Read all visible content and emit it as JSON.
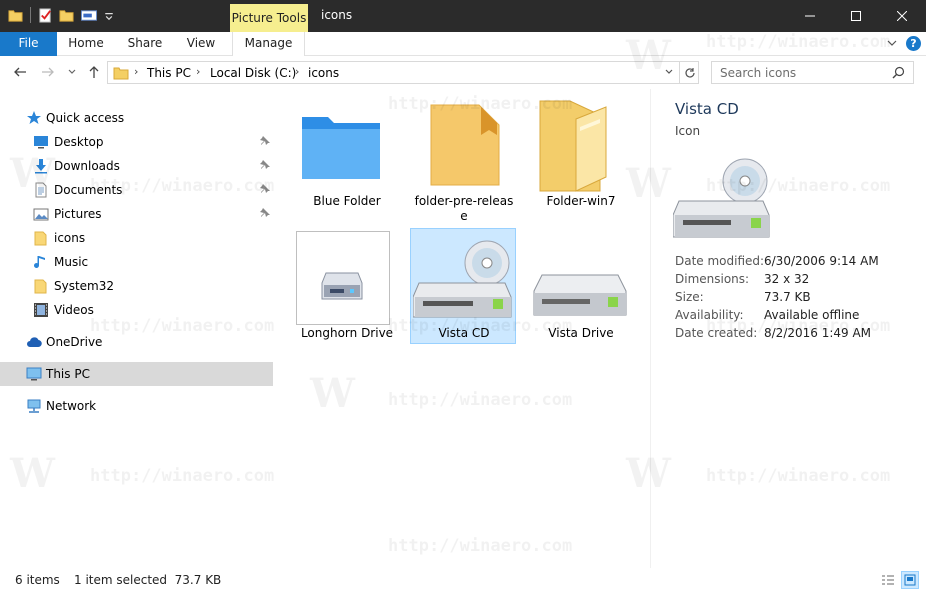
{
  "window": {
    "title": "icons",
    "contextual_tab": "Picture Tools",
    "accent_color": "#1979ca",
    "contextual_color": "#f6ee8f"
  },
  "ribbon": {
    "tabs": [
      {
        "label": "File"
      },
      {
        "label": "Home"
      },
      {
        "label": "Share"
      },
      {
        "label": "View"
      },
      {
        "label": "Manage"
      }
    ],
    "help": "?"
  },
  "address": {
    "crumbs": [
      "This PC",
      "Local Disk (C:)",
      "icons"
    ],
    "search_placeholder": "Search icons"
  },
  "navpane": {
    "items": [
      {
        "label": "Quick access",
        "icon": "star-icon"
      },
      {
        "label": "Desktop",
        "icon": "desktop-icon",
        "pinned": true
      },
      {
        "label": "Downloads",
        "icon": "download-arrow-icon",
        "pinned": true
      },
      {
        "label": "Documents",
        "icon": "documents-icon",
        "pinned": true
      },
      {
        "label": "Pictures",
        "icon": "pictures-icon",
        "pinned": true
      },
      {
        "label": "icons",
        "icon": "folder-icon"
      },
      {
        "label": "Music",
        "icon": "music-note-icon"
      },
      {
        "label": "System32",
        "icon": "folder-icon"
      },
      {
        "label": "Videos",
        "icon": "film-icon"
      },
      {
        "label": "OneDrive",
        "icon": "cloud-icon"
      },
      {
        "label": "This PC",
        "icon": "computer-icon",
        "selected": true
      },
      {
        "label": "Network",
        "icon": "network-icon"
      }
    ]
  },
  "files": [
    {
      "name": "Blue Folder",
      "icon": "blue-folder-icon"
    },
    {
      "name": "folder-pre-release",
      "icon": "folder-pre-release-icon"
    },
    {
      "name": "Folder-win7",
      "icon": "folder-win7-icon"
    },
    {
      "name": "Longhorn Drive",
      "icon": "longhorn-drive-icon"
    },
    {
      "name": "Vista CD",
      "icon": "vista-cd-icon",
      "selected": true
    },
    {
      "name": "Vista Drive",
      "icon": "vista-drive-icon"
    }
  ],
  "details": {
    "title": "Vista CD",
    "type": "Icon",
    "props": [
      {
        "key": "Date modified:",
        "value": "6/30/2006 9:14 AM"
      },
      {
        "key": "Dimensions:",
        "value": "32 x 32"
      },
      {
        "key": "Size:",
        "value": "73.7 KB"
      },
      {
        "key": "Availability:",
        "value": "Available offline"
      },
      {
        "key": "Date created:",
        "value": "8/2/2016 1:49 AM"
      }
    ]
  },
  "status": {
    "item_count": "6 items",
    "selection": "1 item selected  73.7 KB"
  },
  "watermark": {
    "text": "http://winaero.com",
    "letter": "W"
  }
}
